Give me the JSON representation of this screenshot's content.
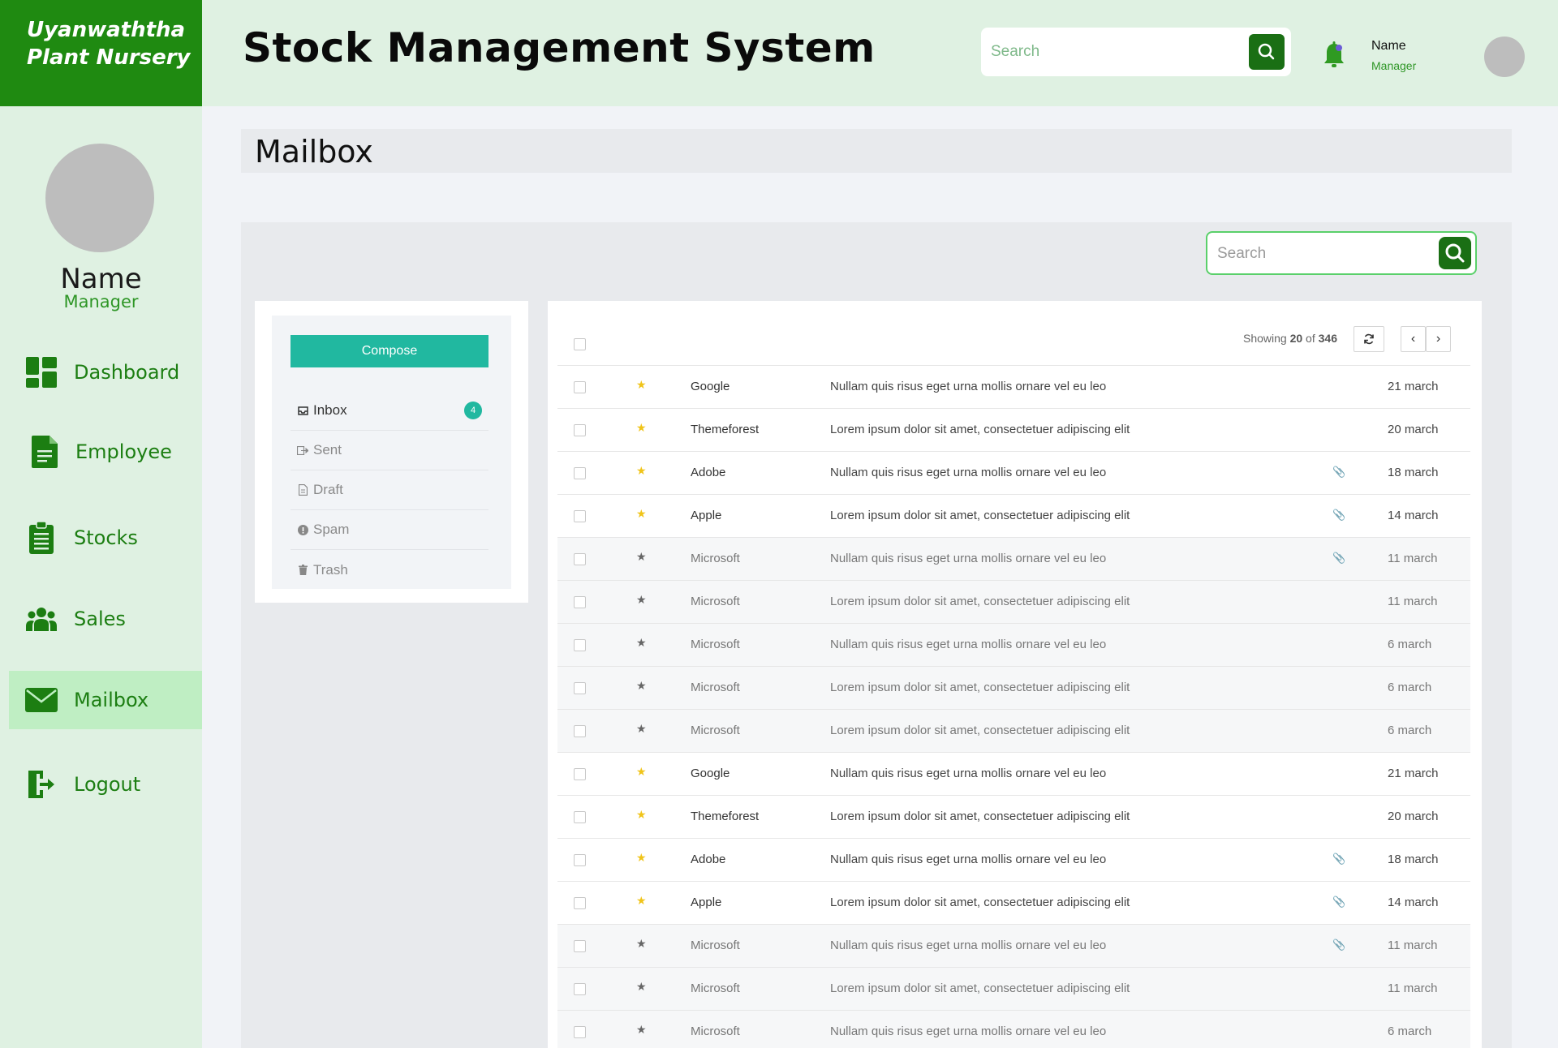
{
  "brand": {
    "line1": "Uyanwaththa",
    "line2": "Plant Nursery"
  },
  "header": {
    "title": "Stock Management System",
    "search_placeholder": "Search",
    "user_name": "Name",
    "user_role": "Manager"
  },
  "sidebar": {
    "profile_name": "Name",
    "profile_role": "Manager",
    "items": [
      {
        "label": "Dashboard",
        "icon": "dashboard-icon"
      },
      {
        "label": "Employee",
        "icon": "document-icon"
      },
      {
        "label": "Stocks",
        "icon": "clipboard-icon"
      },
      {
        "label": "Sales",
        "icon": "users-icon"
      },
      {
        "label": "Mailbox",
        "icon": "envelope-icon",
        "active": true
      },
      {
        "label": "Logout",
        "icon": "logout-icon"
      }
    ]
  },
  "page": {
    "title": "Mailbox"
  },
  "mailbox": {
    "search_placeholder": "Search",
    "compose_label": "Compose",
    "folders": [
      {
        "label": "Inbox",
        "icon": "inbox-icon",
        "badge": "4",
        "active": true
      },
      {
        "label": "Sent",
        "icon": "sent-icon"
      },
      {
        "label": "Draft",
        "icon": "draft-icon"
      },
      {
        "label": "Spam",
        "icon": "spam-icon"
      },
      {
        "label": "Trash",
        "icon": "trash-icon"
      }
    ],
    "showing_prefix": "Showing ",
    "showing_count": "20",
    "showing_mid": " of ",
    "showing_total": "346",
    "rows": [
      {
        "from": "Google",
        "subject": "Nullam quis risus eget urna mollis ornare vel eu leo",
        "date": "21 march",
        "starred": true,
        "read": false,
        "attachment": false
      },
      {
        "from": "Themeforest",
        "subject": "Lorem ipsum dolor sit amet, consectetuer adipiscing elit",
        "date": "20 march",
        "starred": true,
        "read": false,
        "attachment": false
      },
      {
        "from": "Adobe",
        "subject": "Nullam quis risus eget urna mollis ornare vel eu leo",
        "date": "18 march",
        "starred": true,
        "read": false,
        "attachment": true
      },
      {
        "from": "Apple",
        "subject": "Lorem ipsum dolor sit amet, consectetuer adipiscing elit",
        "date": "14 march",
        "starred": true,
        "read": false,
        "attachment": true
      },
      {
        "from": "Microsoft",
        "subject": "Nullam quis risus eget urna mollis ornare vel eu leo",
        "date": "11 march",
        "starred": false,
        "read": true,
        "attachment": true
      },
      {
        "from": "Microsoft",
        "subject": "Lorem ipsum dolor sit amet, consectetuer adipiscing elit",
        "date": "11 march",
        "starred": false,
        "read": true,
        "attachment": false
      },
      {
        "from": "Microsoft",
        "subject": "Nullam quis risus eget urna mollis ornare vel eu leo",
        "date": "6 march",
        "starred": false,
        "read": true,
        "attachment": false
      },
      {
        "from": "Microsoft",
        "subject": "Lorem ipsum dolor sit amet, consectetuer adipiscing elit",
        "date": "6 march",
        "starred": false,
        "read": true,
        "attachment": false
      },
      {
        "from": "Microsoft",
        "subject": "Lorem ipsum dolor sit amet, consectetuer adipiscing elit",
        "date": "6 march",
        "starred": true,
        "read": true,
        "attachment": false
      },
      {
        "from": "Google",
        "subject": "Nullam quis risus eget urna mollis ornare vel eu leo",
        "date": "21 march",
        "starred": true,
        "read": false,
        "attachment": false
      },
      {
        "from": "Themeforest",
        "subject": "Lorem ipsum dolor sit amet, consectetuer adipiscing elit",
        "date": "20 march",
        "starred": true,
        "read": false,
        "attachment": false
      },
      {
        "from": "Adobe",
        "subject": "Nullam quis risus eget urna mollis ornare vel eu leo",
        "date": "18 march",
        "starred": true,
        "read": false,
        "attachment": true
      },
      {
        "from": "Apple",
        "subject": "Lorem ipsum dolor sit amet, consectetuer adipiscing elit",
        "date": "14 march",
        "starred": true,
        "read": false,
        "attachment": true
      },
      {
        "from": "Microsoft",
        "subject": "Nullam quis risus eget urna mollis ornare vel eu leo",
        "date": "11 march",
        "starred": false,
        "read": true,
        "attachment": true
      },
      {
        "from": "Microsoft",
        "subject": "Lorem ipsum dolor sit amet, consectetuer adipiscing elit",
        "date": "11 march",
        "starred": false,
        "read": true,
        "attachment": false
      },
      {
        "from": "Microsoft",
        "subject": "Nullam quis risus eget urna mollis ornare vel eu leo",
        "date": "6 march",
        "starred": false,
        "read": true,
        "attachment": false
      }
    ]
  },
  "colors": {
    "brand_green": "#1f8a11",
    "light_green": "#dff1e2",
    "active_nav": "#bfeec3",
    "accent_teal": "#21b8a0",
    "star_yellow": "#f0c419"
  }
}
